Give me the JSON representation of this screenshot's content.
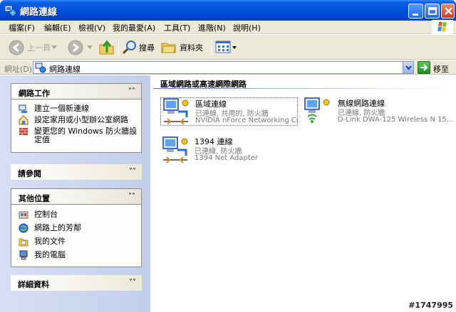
{
  "window": {
    "title": "網路連線",
    "controls": [
      "minimize",
      "maximize",
      "close"
    ]
  },
  "menu": {
    "items": [
      "檔案(F)",
      "編輯(E)",
      "檢視(V)",
      "我的最愛(A)",
      "工具(T)",
      "進階(N)",
      "說明(H)"
    ]
  },
  "toolbar": {
    "back_label": "上一頁",
    "search_label": "搜尋",
    "folders_label": "資料夾"
  },
  "address": {
    "label": "網址(D)",
    "value": "網路連線",
    "go_label": "移至"
  },
  "sidebar": {
    "network_tasks": {
      "title": "網路工作",
      "items": [
        "建立一個新連線",
        "設定家用或小型辦公室網路",
        "變更您的 Windows 防火牆設",
        "定值"
      ]
    },
    "see_also": {
      "title": "請參閱"
    },
    "other_places": {
      "title": "其他位置",
      "items": [
        "控制台",
        "網路上的芳鄰",
        "我的文件",
        "我的電腦"
      ]
    },
    "details": {
      "title": "詳細資料"
    }
  },
  "main": {
    "group_title": "區域網路或高速網際網路",
    "connections": [
      {
        "name": "區域連線",
        "status": "已連線, 共用的, 防火牆",
        "device": "NVIDIA nForce Networking Co..."
      },
      {
        "name": "無線網路連線",
        "status": "已連線, 防火牆",
        "device": "D-Link DWA-125 Wireless N 15..."
      },
      {
        "name": "1394 連線",
        "status": "已連線, 防火牆",
        "device": "1394 Net Adapter"
      }
    ]
  },
  "watermark": "#1747995",
  "colors": {
    "titlebar": "#0050dc",
    "chrome": "#ece9d8",
    "sidebar": "#c3cfea",
    "group_line": "#4c6fc4"
  }
}
